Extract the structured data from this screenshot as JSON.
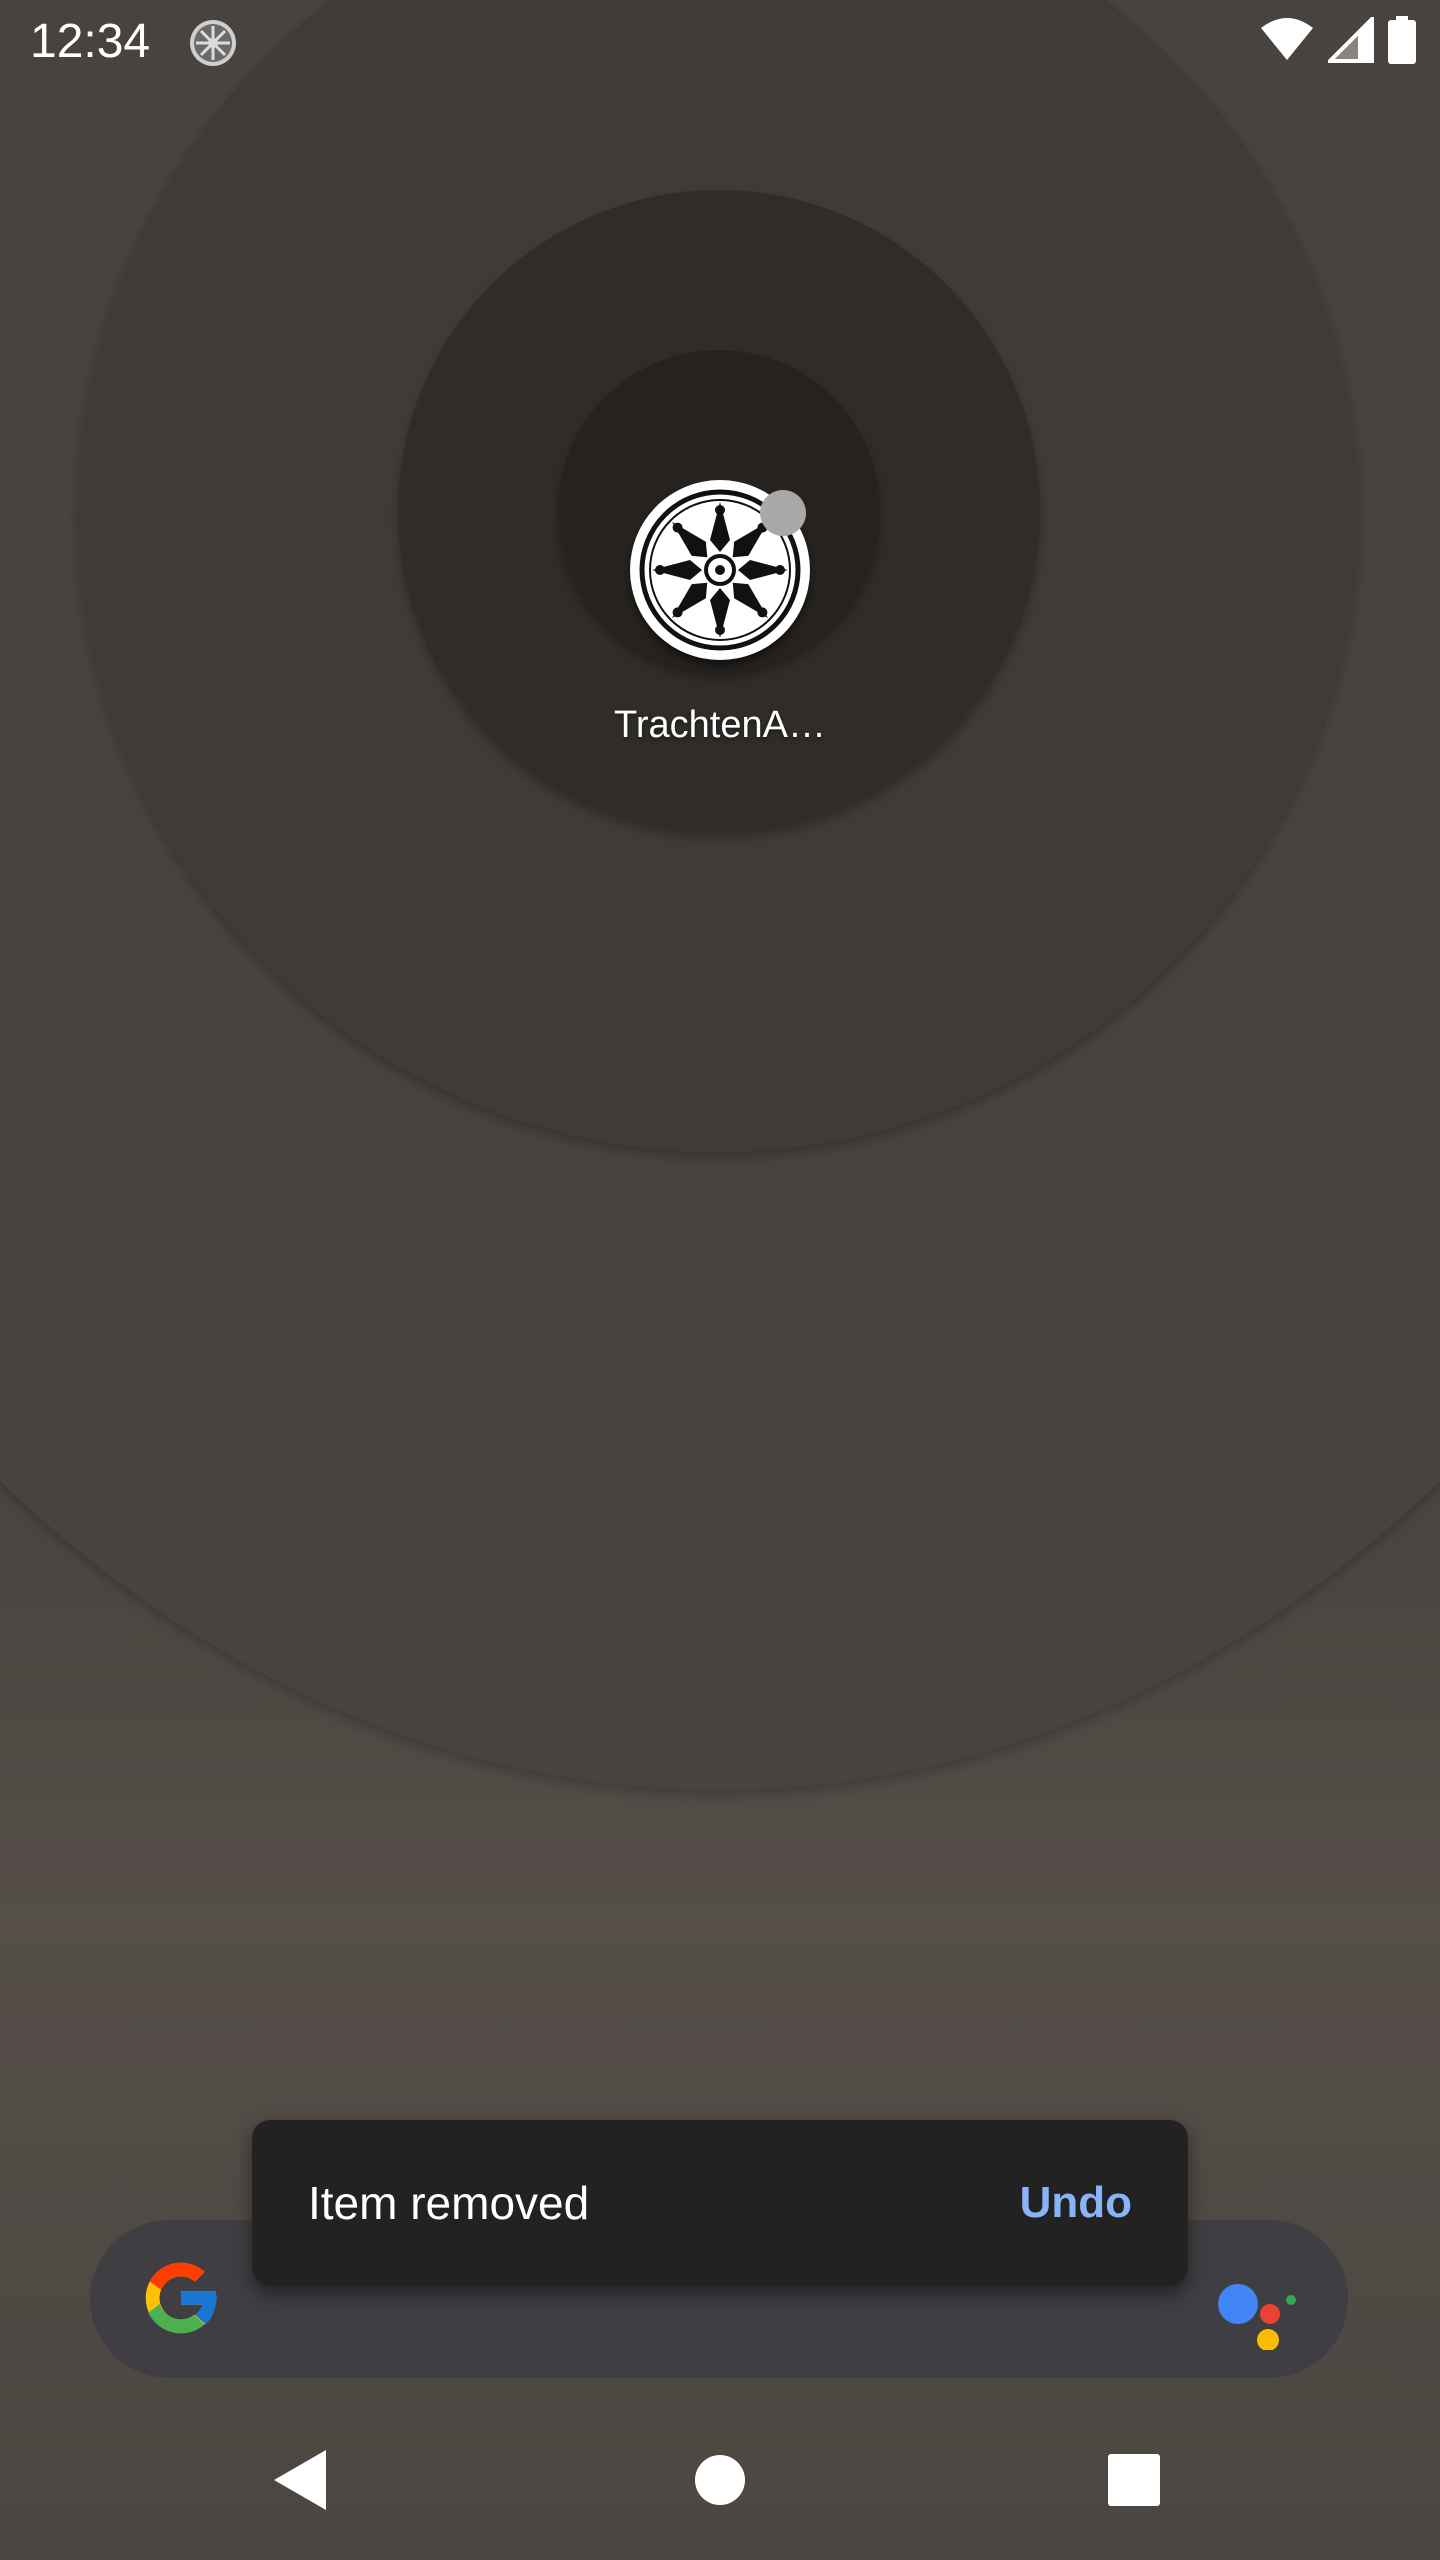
{
  "status_bar": {
    "time": "12:34",
    "icons": [
      "notification-app-icon",
      "wifi-icon",
      "cell-signal-icon",
      "battery-icon"
    ]
  },
  "home": {
    "app_shortcut": {
      "label": "TrachtenA…",
      "icon": "trachten-app-icon",
      "has_notification_dot": true
    }
  },
  "snackbar": {
    "message": "Item removed",
    "action_label": "Undo",
    "action_color": "#8ab4f8",
    "background": "#222222"
  },
  "search_bar": {
    "left_icon": "google-g-icon",
    "right_icon": "google-assistant-icon"
  },
  "nav_bar": {
    "buttons": [
      "back-icon",
      "home-icon",
      "recents-icon"
    ]
  }
}
